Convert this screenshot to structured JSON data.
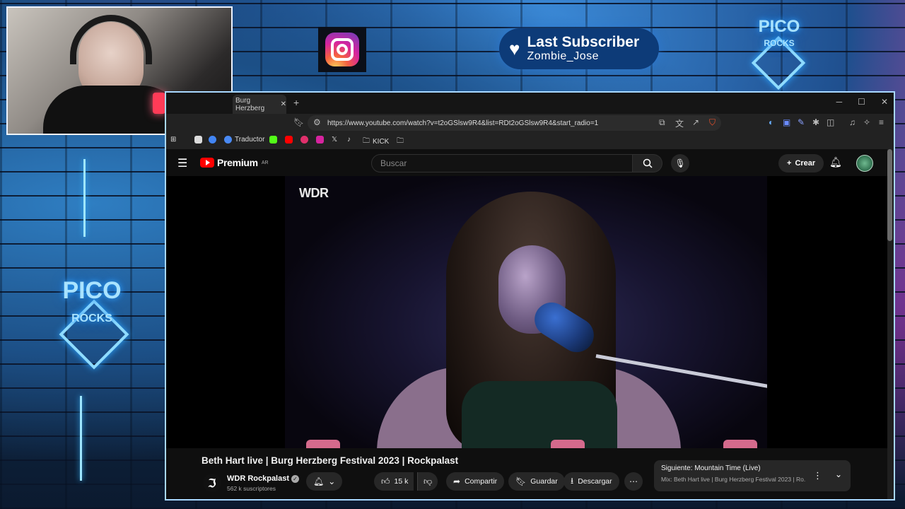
{
  "overlay": {
    "subscriber_title": "Last Subscriber",
    "subscriber_name": "Zombie_Jose",
    "logo_top": "PICO",
    "logo_bottom": "ROCKS"
  },
  "browser": {
    "tab_title": "Burg Herzberg",
    "url": "https://www.youtube.com/watch?v=t2oGSlsw9R4&list=RDt2oGSlsw9R4&start_radio=1",
    "bookmarks": [
      {
        "label": "",
        "color": "#4285f4"
      },
      {
        "label": "Traductor",
        "color": "#4a8af4"
      },
      {
        "label": "",
        "color": "#53fc18"
      },
      {
        "label": "",
        "color": "#ff0000"
      },
      {
        "label": "",
        "color": "#e1306c"
      },
      {
        "label": "",
        "color": "#d6249f"
      },
      {
        "label": "",
        "color": "#000000"
      },
      {
        "label": "",
        "color": "#000000"
      },
      {
        "label": "KICK",
        "color": ""
      }
    ]
  },
  "youtube": {
    "logo_text": "Premium",
    "region": "AR",
    "search_placeholder": "Buscar",
    "create_label": "Crear",
    "video_watermark": "WDR",
    "video_title": "Beth Hart live | Burg Herzberg Festival 2023 | Rockpalast",
    "channel_name": "WDR Rockpalast",
    "channel_subs": "562 k suscriptores",
    "likes": "15 k",
    "share_label": "Compartir",
    "save_label": "Guardar",
    "download_label": "Descargar",
    "up_next_label": "Siguiente: Mountain Time (Live)",
    "up_next_mix": "Mix: Beth Hart live | Burg Herzberg Festival 2023 | Ro..."
  }
}
